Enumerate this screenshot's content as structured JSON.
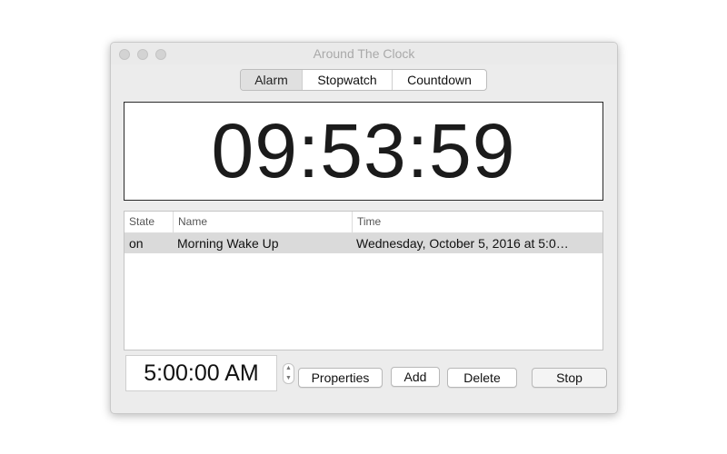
{
  "window": {
    "title": "Around The Clock"
  },
  "tabs": [
    {
      "label": "Alarm",
      "selected": true
    },
    {
      "label": "Stopwatch",
      "selected": false
    },
    {
      "label": "Countdown",
      "selected": false
    }
  ],
  "clock": {
    "display": "09:53:59"
  },
  "alarm_table": {
    "columns": [
      "State",
      "Name",
      "Time"
    ],
    "rows": [
      {
        "state": "on",
        "name": "Morning Wake Up",
        "time": "Wednesday, October 5, 2016 at 5:0…",
        "selected": true
      }
    ]
  },
  "controls": {
    "time_value": "5:00:00 AM",
    "stepper_up_icon": "chevron-up-icon",
    "stepper_down_icon": "chevron-down-icon",
    "properties_label": "Properties",
    "add_label": "Add",
    "delete_label": "Delete",
    "stop_label": "Stop"
  },
  "colors": {
    "window_bg": "#ececec",
    "selected_row": "#dadada",
    "active_tab": "#e0e0e0"
  }
}
